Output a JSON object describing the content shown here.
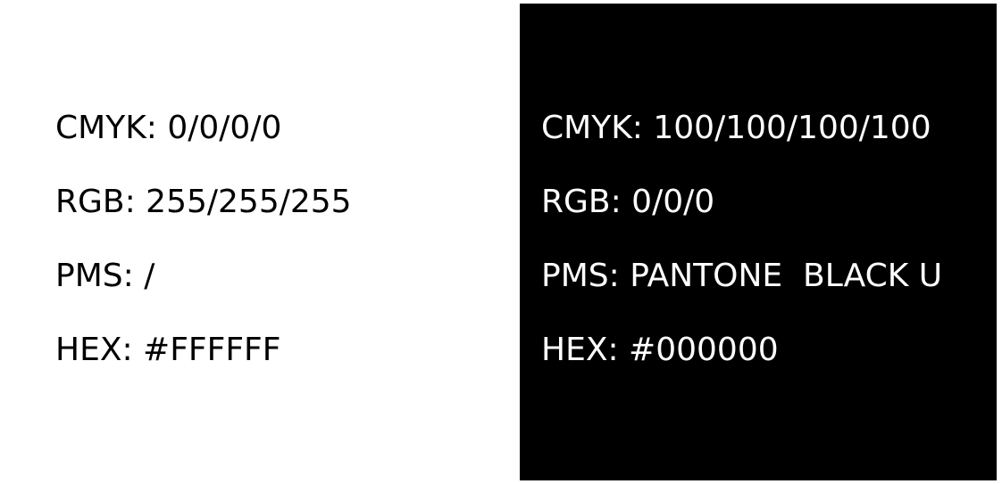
{
  "swatches": [
    {
      "name": "white",
      "background": "#FFFFFF",
      "text_color": "#000000",
      "lines": {
        "cmyk": "CMYK: 0/0/0/0",
        "rgb": "RGB: 255/255/255",
        "pms": "PMS: /",
        "hex": "HEX: #FFFFFF"
      }
    },
    {
      "name": "black",
      "background": "#000000",
      "text_color": "#FFFFFF",
      "lines": {
        "cmyk": "CMYK: 100/100/100/100",
        "rgb": "RGB: 0/0/0",
        "pms": "PMS: PANTONE  BLACK U",
        "hex": "HEX: #000000"
      }
    }
  ]
}
